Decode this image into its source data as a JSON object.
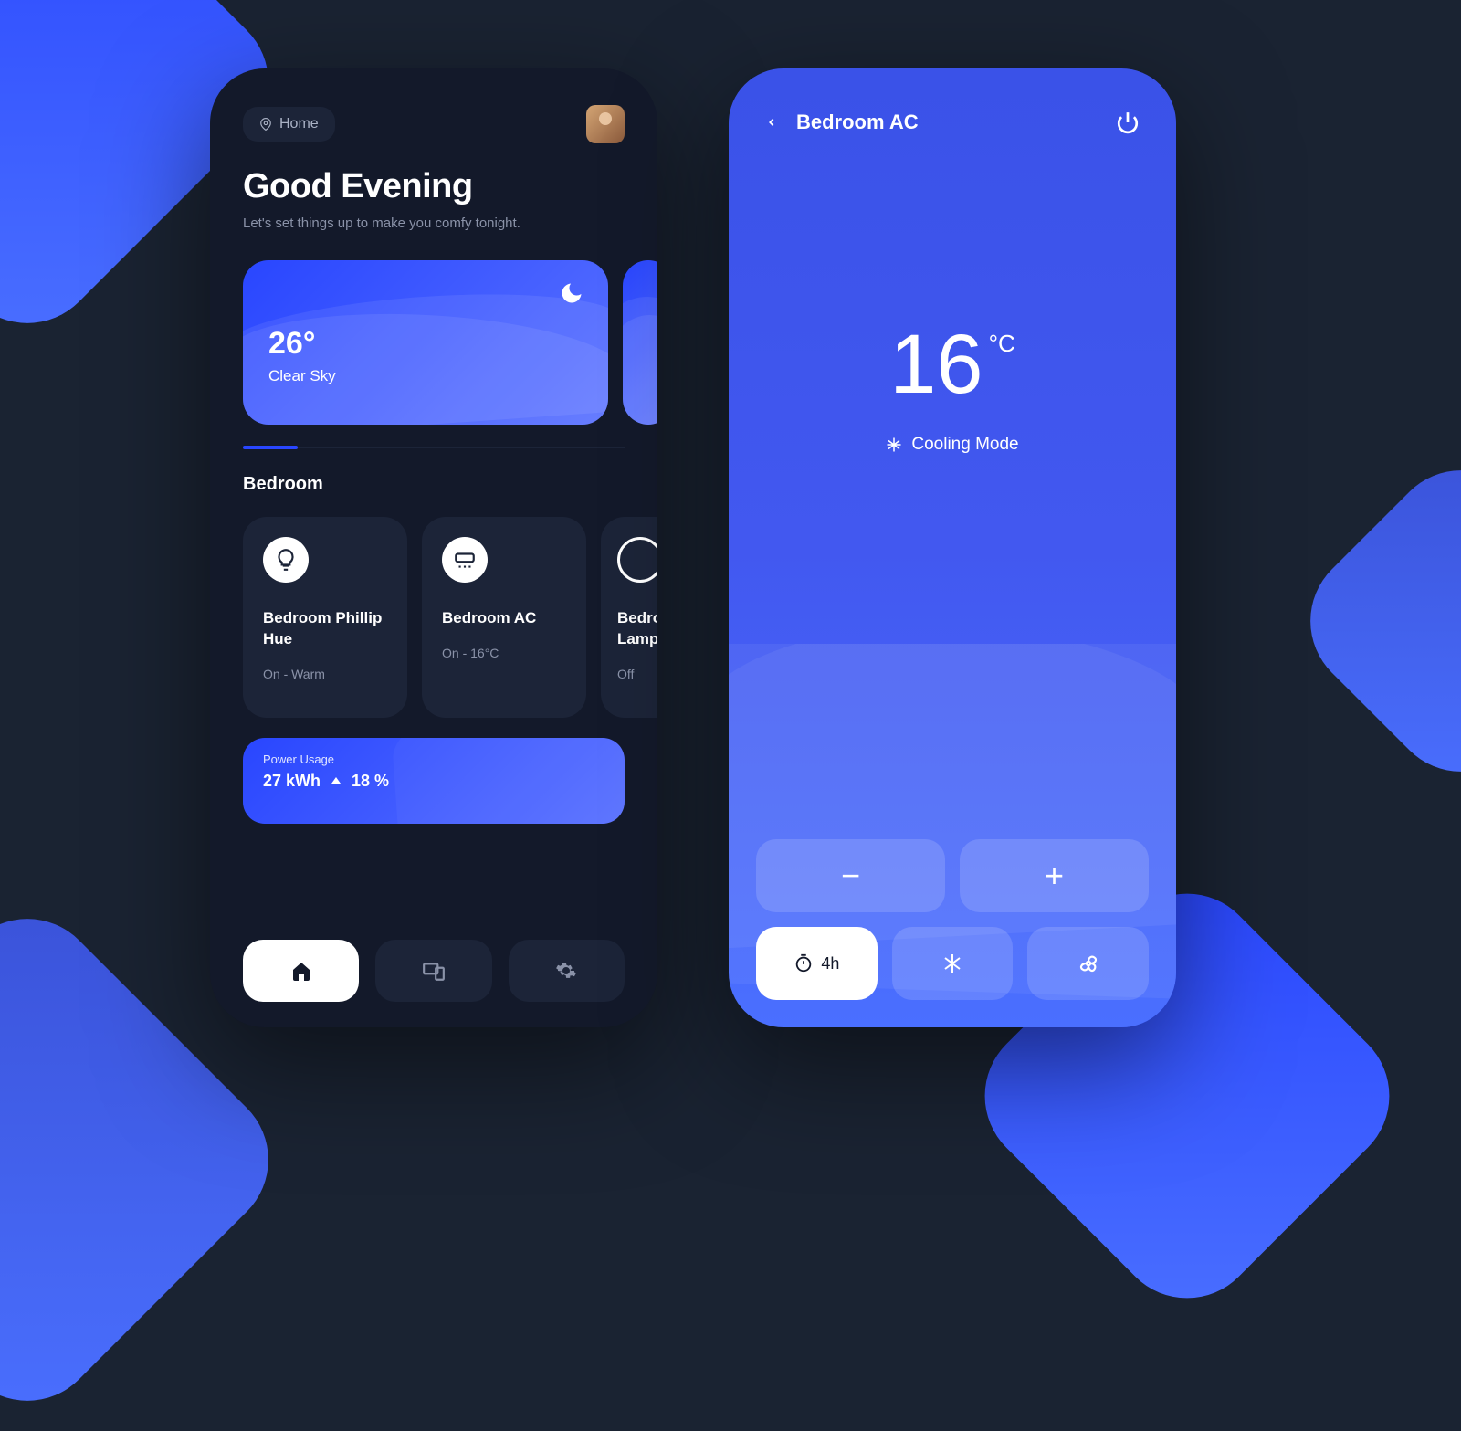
{
  "left": {
    "location_label": "Home",
    "greeting_title": "Good Evening",
    "greeting_sub": "Let's set things up to make you comfy tonight.",
    "weather": {
      "temp": "26°",
      "desc": "Clear Sky"
    },
    "room_label": "Bedroom",
    "devices": [
      {
        "name": "Bedroom Phillip Hue",
        "status": "On - Warm",
        "icon": "bulb"
      },
      {
        "name": "Bedroom AC",
        "status": "On - 16°C",
        "icon": "ac"
      },
      {
        "name": "Bedroom Lamp",
        "status": "Off",
        "icon": "circle"
      }
    ],
    "power": {
      "label": "Power Usage",
      "kwh": "27 kWh",
      "pct": "18 %"
    }
  },
  "right": {
    "title": "Bedroom AC",
    "temp": "16",
    "unit": "°C",
    "mode": "Cooling Mode",
    "timer": "4h"
  }
}
